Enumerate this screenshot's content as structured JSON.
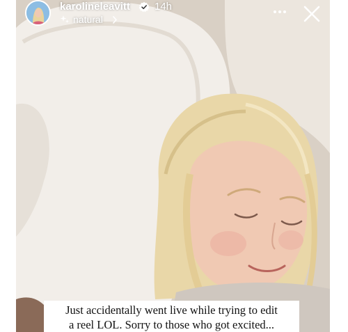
{
  "story": {
    "username": "karolineleavitt",
    "time_ago": "14h",
    "audio_label": "natural",
    "caption_line1": "Just accidentally went live while trying to edit",
    "caption_line2": "a reel LOL. Sorry to those who got excited..."
  },
  "icons": {
    "verified": "verified-badge-icon",
    "audio": "sparkle-icon",
    "chevron": "chevron-right-icon",
    "more": "more-icon",
    "close": "close-icon"
  },
  "colors": {
    "verified_badge": "#ffffff",
    "text": "#ffffff",
    "caption_background": "#ffffff"
  }
}
